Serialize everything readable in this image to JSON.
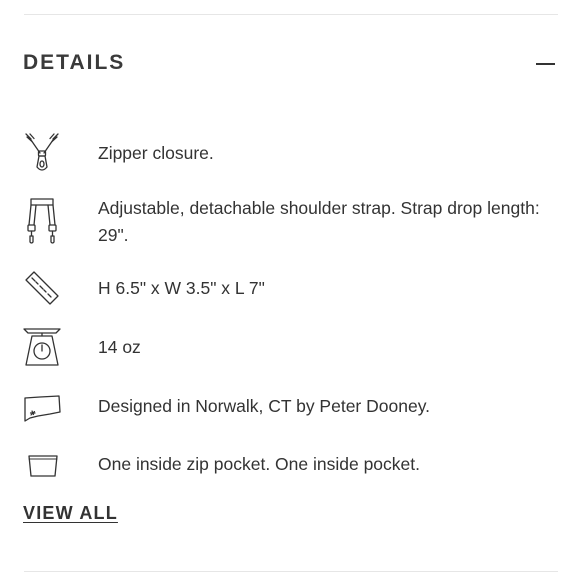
{
  "section": {
    "title": "DETAILS",
    "collapse_icon": "minus-icon"
  },
  "details": [
    {
      "icon": "zipper-icon",
      "text": "Zipper closure."
    },
    {
      "icon": "shoulder-strap-icon",
      "text": "Adjustable, detachable shoulder strap. Strap drop length: 29\"."
    },
    {
      "icon": "ruler-icon",
      "text": "H 6.5\" x W 3.5\" x L 7\""
    },
    {
      "icon": "scale-icon",
      "text": "14 oz"
    },
    {
      "icon": "connecticut-map-icon",
      "text": "Designed in Norwalk, CT by Peter Dooney."
    },
    {
      "icon": "pocket-icon",
      "text": "One inside zip pocket. One inside pocket."
    }
  ],
  "view_all_label": "VIEW ALL"
}
